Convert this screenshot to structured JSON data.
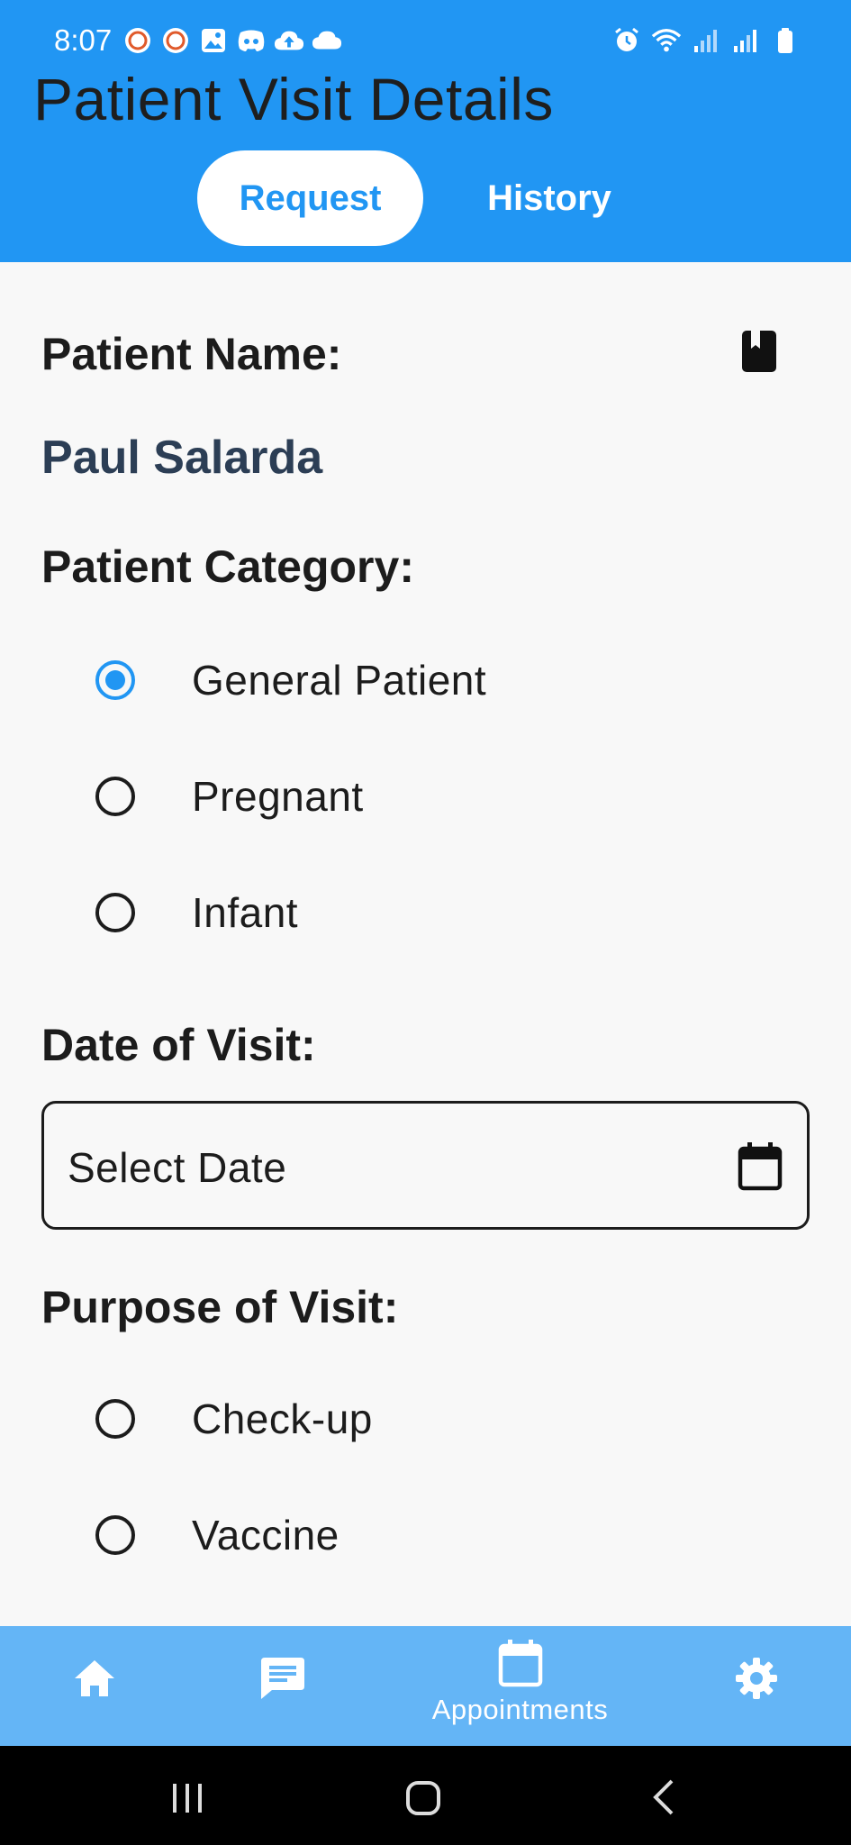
{
  "status_bar": {
    "time": "8:07",
    "left_icons": [
      "app-notification-icon",
      "app-notification-icon",
      "image-icon",
      "discord-icon",
      "cloud-upload-icon",
      "cloud-icon"
    ],
    "right_icons": [
      "alarm-icon",
      "wifi-icon",
      "signal-icon",
      "signal-icon",
      "battery-icon"
    ]
  },
  "header": {
    "title": "Patient Visit Details",
    "tabs": [
      {
        "label": "Request",
        "active": true
      },
      {
        "label": "History",
        "active": false
      }
    ]
  },
  "form": {
    "patient_name_label": "Patient Name:",
    "patient_name_value": "Paul Salarda",
    "category_label": "Patient Category:",
    "category_options": [
      {
        "label": "General Patient",
        "selected": true
      },
      {
        "label": "Pregnant",
        "selected": false
      },
      {
        "label": "Infant",
        "selected": false
      }
    ],
    "date_label": "Date of Visit:",
    "date_placeholder": "Select Date",
    "purpose_label": "Purpose of Visit:",
    "purpose_options": [
      {
        "label": "Check-up",
        "selected": false
      },
      {
        "label": "Vaccine",
        "selected": false
      }
    ]
  },
  "bottom_nav": {
    "items": [
      {
        "icon": "home-icon",
        "label": ""
      },
      {
        "icon": "chat-icon",
        "label": ""
      },
      {
        "icon": "calendar-icon",
        "label": "Appointments",
        "active": true
      },
      {
        "icon": "settings-icon",
        "label": ""
      }
    ]
  },
  "colors": {
    "primary": "#2196f3",
    "nav_bg": "#64b5f6",
    "background": "#f8f8f8",
    "name_text": "#2c3e55"
  }
}
